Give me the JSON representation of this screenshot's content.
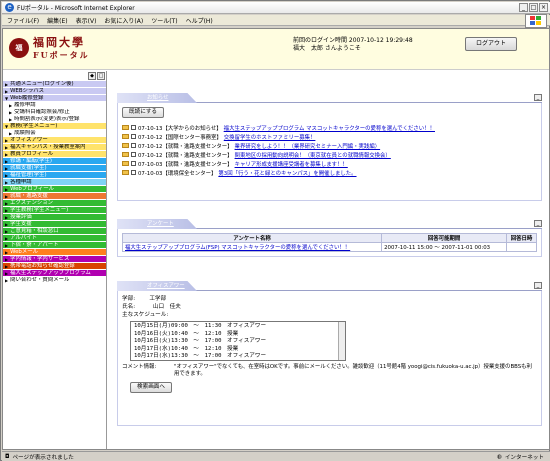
{
  "window": {
    "title": "FUポータル - Microsoft Internet Explorer",
    "controls": [
      "_",
      "□",
      "×"
    ]
  },
  "menu": [
    "ファイル(F)",
    "編集(E)",
    "表示(V)",
    "お気に入り(A)",
    "ツール(T)",
    "ヘルプ(H)"
  ],
  "header": {
    "seal": "福",
    "logo_line1": "福岡大學",
    "logo_line2": "FUポータル",
    "last_login": "前回のログイン時間 2007-10-12 19:29:48",
    "greeting": "福大　太郎 さんようこそ",
    "logout_label": "ログアウト"
  },
  "sidebar": {
    "controls": [
      "◆",
      "□"
    ],
    "items": [
      {
        "label": "共通メニュー(ログイン後)",
        "color": "#c9c9f2",
        "tri": "▶"
      },
      {
        "label": "WEBシラバス",
        "color": "#c9c9f2",
        "tri": "▶"
      },
      {
        "label": "Web履修登録",
        "color": "#c9c9f2",
        "tri": "▼"
      },
      {
        "label": "履修申請",
        "color": "#ffffff",
        "tri": "▶",
        "sub": true
      },
      {
        "label": "受講科目確認照会/修正",
        "color": "#ffffff",
        "tri": "▶",
        "sub": true
      },
      {
        "label": "時間割表示(変更)表示/登録",
        "color": "#ffffff",
        "tri": "▶",
        "sub": true
      },
      {
        "label": "教務(学生メニュー)",
        "color": "#ffe36b",
        "tri": "▼"
      },
      {
        "label": "成績照会",
        "color": "#ffffff",
        "tri": "▶",
        "sub": true
      },
      {
        "label": "オフィスアワー",
        "color": "#ffe36b",
        "tri": "▶"
      },
      {
        "label": "福大キャンパス・授業教室案内",
        "color": "#ffe36b",
        "tri": "▶"
      },
      {
        "label": "教員プロフィール",
        "color": "#ffe36b",
        "tri": "▶"
      },
      {
        "label": "修講・編転(学生)",
        "color": "#29a8f0",
        "tri": "▶"
      },
      {
        "label": "就職支援(学生)",
        "color": "#29a8f0",
        "tri": "▶"
      },
      {
        "label": "福祉管理(学生)",
        "color": "#29a8f0",
        "tri": "▶"
      },
      {
        "label": "各種申請",
        "color": "#7fd3f5",
        "tri": "▶"
      },
      {
        "label": "Webプロフィール",
        "color": "#33bb33",
        "tri": "▶"
      },
      {
        "label": "就職・進路支援",
        "color": "#ee7733",
        "tri": "▶"
      },
      {
        "label": "エクステンション",
        "color": "#33bb33",
        "tri": "▶"
      },
      {
        "label": "学生教務(学生メニュー)",
        "color": "#33bb33",
        "tri": "▶"
      },
      {
        "label": "授業評価",
        "color": "#33bb33",
        "tri": "▶"
      },
      {
        "label": "学生支援",
        "color": "#33bb33",
        "tri": "▶"
      },
      {
        "label": "ご意見箱・相談窓口",
        "color": "#33bb33",
        "tri": "▶"
      },
      {
        "label": "アルバイト",
        "color": "#33bb33",
        "tri": "▶"
      },
      {
        "label": "下宿・寮・アパート",
        "color": "#33bb33",
        "tri": "▶"
      },
      {
        "label": "Webメール",
        "color": "#ff7f1e",
        "tri": "▶"
      },
      {
        "label": "学内情報・学内サービス",
        "color": "#b000b0",
        "tri": "▶"
      },
      {
        "label": "携帯電話お知らせ確認登録",
        "color": "#d84400",
        "tri": "▶"
      },
      {
        "label": "福大生ステップアッププログラム",
        "color": "#b000b0",
        "tri": "▶"
      },
      {
        "label": "問い合わせ・質問メール",
        "color": "#ffffff",
        "tri": "▶"
      }
    ]
  },
  "notice": {
    "tab": "お知らせ",
    "read_label": "既読にする",
    "items": [
      {
        "date": "07-10-13【大学からのお知らせ】",
        "link": "福大生ステップアッププログラム マスコットキャラクターの愛称を選んでください！！"
      },
      {
        "date": "07-10-12【国際センター事務室】",
        "link": "交換留学生のホストファミリー募集！"
      },
      {
        "date": "07-10-12【就職・進路支援センター】",
        "link": "業界研究をしよう！！（業界研究セミナー入門編・実践編）"
      },
      {
        "date": "07-10-12【就職・進路支援センター】",
        "link": "関東地区の採用動向説明会！（東京就在員との就職情報交換会）"
      },
      {
        "date": "07-10-03【就職・進路支援センター】",
        "link": "キャリア形成支援講座受講者を募集します！！"
      },
      {
        "date": "07-10-03【環境保全センター】",
        "link": "第3回「行う・花と緑とのキャンパス」を開催しました。"
      }
    ]
  },
  "survey": {
    "tab": "アンケート",
    "headers": [
      "アンケート名称",
      "回答可能期間",
      "回答日時"
    ],
    "rows": [
      {
        "name": "福大生ステップアッププログラム(FSP) マスコットキャラクターの愛称を選んでください！！",
        "period": "2007-10-11 15:00 ～ 2007-11-01 00:03",
        "answered": ""
      }
    ]
  },
  "office": {
    "tab": "オフィスアワー",
    "dept_label": "学部:",
    "dept_value": "工学部",
    "name_label": "氏名:",
    "name_value": "山口　佳夫",
    "schedule_label": "主なスケジュール:",
    "schedule": [
      "10月15日(月)09:00　～　11:30　オフィスアワー",
      "10月16日(火)10:40　～　12:10　授業",
      "10月16日(火)13:30　～　17:00　オフィスアワー",
      "10月17日(水)10:40　～　12:10　授業",
      "10月17日(水)13:30　～　17:00　オフィスアワー"
    ],
    "comment_label": "コメント情報:",
    "comment_text": "\"オフィスアワー\"でなくても、在室時はOKです。事前にメールください。雑談歓迎（11号館4階 yoogi@cis.fukuoka-u.ac.jp）授業支援のBBSも利用できます。",
    "search_label": "検索画面へ"
  },
  "status": {
    "left": "ページが表示されました",
    "right": "インターネット"
  }
}
